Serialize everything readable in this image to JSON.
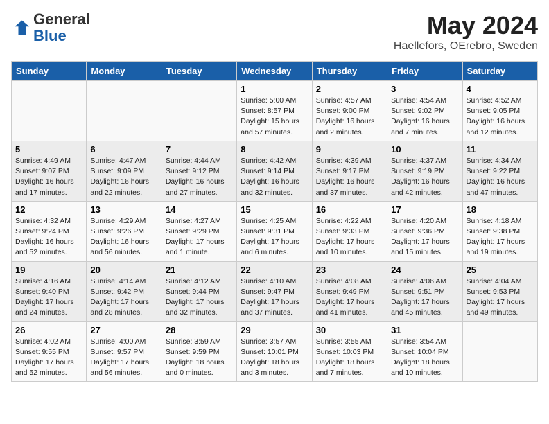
{
  "header": {
    "logo_general": "General",
    "logo_blue": "Blue",
    "month_title": "May 2024",
    "location": "Haellefors, OErebro, Sweden"
  },
  "weekdays": [
    "Sunday",
    "Monday",
    "Tuesday",
    "Wednesday",
    "Thursday",
    "Friday",
    "Saturday"
  ],
  "weeks": [
    [
      {
        "day": "",
        "info": ""
      },
      {
        "day": "",
        "info": ""
      },
      {
        "day": "",
        "info": ""
      },
      {
        "day": "1",
        "info": "Sunrise: 5:00 AM\nSunset: 8:57 PM\nDaylight: 15 hours\nand 57 minutes."
      },
      {
        "day": "2",
        "info": "Sunrise: 4:57 AM\nSunset: 9:00 PM\nDaylight: 16 hours\nand 2 minutes."
      },
      {
        "day": "3",
        "info": "Sunrise: 4:54 AM\nSunset: 9:02 PM\nDaylight: 16 hours\nand 7 minutes."
      },
      {
        "day": "4",
        "info": "Sunrise: 4:52 AM\nSunset: 9:05 PM\nDaylight: 16 hours\nand 12 minutes."
      }
    ],
    [
      {
        "day": "5",
        "info": "Sunrise: 4:49 AM\nSunset: 9:07 PM\nDaylight: 16 hours\nand 17 minutes."
      },
      {
        "day": "6",
        "info": "Sunrise: 4:47 AM\nSunset: 9:09 PM\nDaylight: 16 hours\nand 22 minutes."
      },
      {
        "day": "7",
        "info": "Sunrise: 4:44 AM\nSunset: 9:12 PM\nDaylight: 16 hours\nand 27 minutes."
      },
      {
        "day": "8",
        "info": "Sunrise: 4:42 AM\nSunset: 9:14 PM\nDaylight: 16 hours\nand 32 minutes."
      },
      {
        "day": "9",
        "info": "Sunrise: 4:39 AM\nSunset: 9:17 PM\nDaylight: 16 hours\nand 37 minutes."
      },
      {
        "day": "10",
        "info": "Sunrise: 4:37 AM\nSunset: 9:19 PM\nDaylight: 16 hours\nand 42 minutes."
      },
      {
        "day": "11",
        "info": "Sunrise: 4:34 AM\nSunset: 9:22 PM\nDaylight: 16 hours\nand 47 minutes."
      }
    ],
    [
      {
        "day": "12",
        "info": "Sunrise: 4:32 AM\nSunset: 9:24 PM\nDaylight: 16 hours\nand 52 minutes."
      },
      {
        "day": "13",
        "info": "Sunrise: 4:29 AM\nSunset: 9:26 PM\nDaylight: 16 hours\nand 56 minutes."
      },
      {
        "day": "14",
        "info": "Sunrise: 4:27 AM\nSunset: 9:29 PM\nDaylight: 17 hours\nand 1 minute."
      },
      {
        "day": "15",
        "info": "Sunrise: 4:25 AM\nSunset: 9:31 PM\nDaylight: 17 hours\nand 6 minutes."
      },
      {
        "day": "16",
        "info": "Sunrise: 4:22 AM\nSunset: 9:33 PM\nDaylight: 17 hours\nand 10 minutes."
      },
      {
        "day": "17",
        "info": "Sunrise: 4:20 AM\nSunset: 9:36 PM\nDaylight: 17 hours\nand 15 minutes."
      },
      {
        "day": "18",
        "info": "Sunrise: 4:18 AM\nSunset: 9:38 PM\nDaylight: 17 hours\nand 19 minutes."
      }
    ],
    [
      {
        "day": "19",
        "info": "Sunrise: 4:16 AM\nSunset: 9:40 PM\nDaylight: 17 hours\nand 24 minutes."
      },
      {
        "day": "20",
        "info": "Sunrise: 4:14 AM\nSunset: 9:42 PM\nDaylight: 17 hours\nand 28 minutes."
      },
      {
        "day": "21",
        "info": "Sunrise: 4:12 AM\nSunset: 9:44 PM\nDaylight: 17 hours\nand 32 minutes."
      },
      {
        "day": "22",
        "info": "Sunrise: 4:10 AM\nSunset: 9:47 PM\nDaylight: 17 hours\nand 37 minutes."
      },
      {
        "day": "23",
        "info": "Sunrise: 4:08 AM\nSunset: 9:49 PM\nDaylight: 17 hours\nand 41 minutes."
      },
      {
        "day": "24",
        "info": "Sunrise: 4:06 AM\nSunset: 9:51 PM\nDaylight: 17 hours\nand 45 minutes."
      },
      {
        "day": "25",
        "info": "Sunrise: 4:04 AM\nSunset: 9:53 PM\nDaylight: 17 hours\nand 49 minutes."
      }
    ],
    [
      {
        "day": "26",
        "info": "Sunrise: 4:02 AM\nSunset: 9:55 PM\nDaylight: 17 hours\nand 52 minutes."
      },
      {
        "day": "27",
        "info": "Sunrise: 4:00 AM\nSunset: 9:57 PM\nDaylight: 17 hours\nand 56 minutes."
      },
      {
        "day": "28",
        "info": "Sunrise: 3:59 AM\nSunset: 9:59 PM\nDaylight: 18 hours\nand 0 minutes."
      },
      {
        "day": "29",
        "info": "Sunrise: 3:57 AM\nSunset: 10:01 PM\nDaylight: 18 hours\nand 3 minutes."
      },
      {
        "day": "30",
        "info": "Sunrise: 3:55 AM\nSunset: 10:03 PM\nDaylight: 18 hours\nand 7 minutes."
      },
      {
        "day": "31",
        "info": "Sunrise: 3:54 AM\nSunset: 10:04 PM\nDaylight: 18 hours\nand 10 minutes."
      },
      {
        "day": "",
        "info": ""
      }
    ]
  ]
}
